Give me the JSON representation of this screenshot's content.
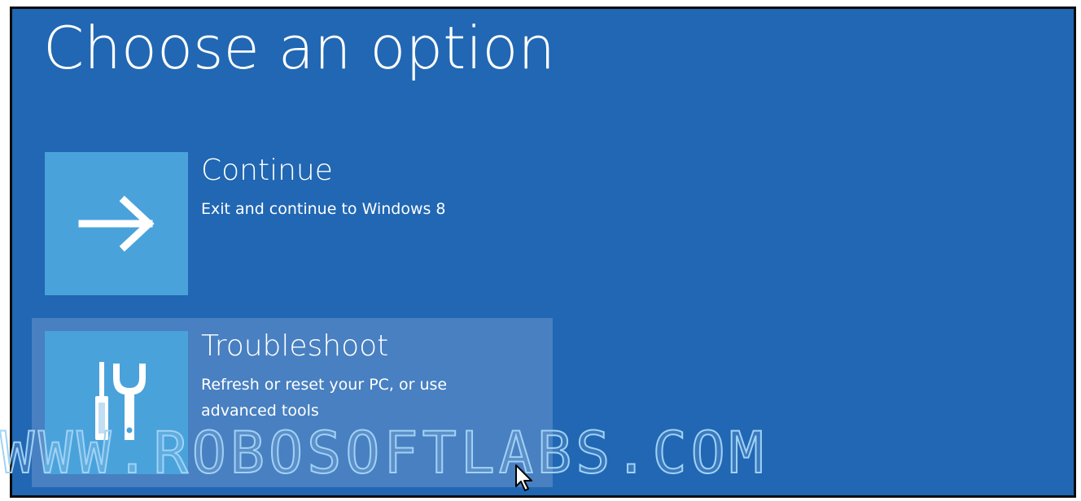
{
  "page": {
    "title": "Choose an option"
  },
  "options": [
    {
      "title": "Continue",
      "description": "Exit and continue to Windows 8",
      "icon": "arrow-right-icon"
    },
    {
      "title": "Troubleshoot",
      "description": "Refresh or reset your PC, or use advanced tools",
      "icon": "tools-icon"
    }
  ],
  "watermark": {
    "text": "WWW.ROBOSOFTLABS.COM"
  },
  "colors": {
    "background": "#2167b3",
    "tile": "#4aa2db",
    "text": "#ffffff"
  }
}
